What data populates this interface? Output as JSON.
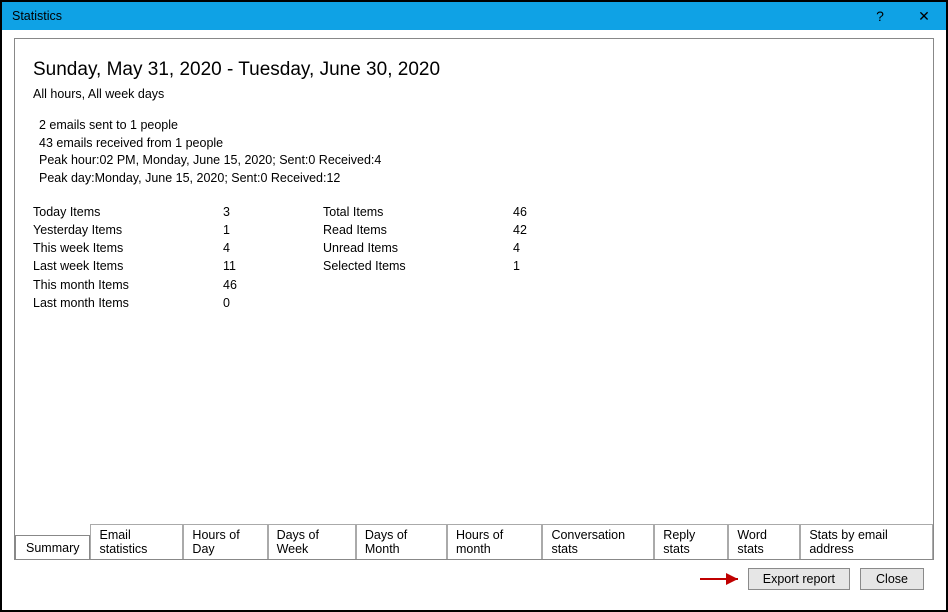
{
  "titlebar": {
    "title": "Statistics",
    "help_label": "?",
    "close_label": "✕"
  },
  "header": {
    "date_range": "Sunday, May 31, 2020 - Tuesday, June 30, 2020",
    "filter_text": "All hours, All week days"
  },
  "details": {
    "line1": "2 emails sent to 1 people",
    "line2": "43 emails received from 1 people",
    "line3": "Peak hour:02 PM, Monday, June 15, 2020; Sent:0 Received:4",
    "line4": "Peak day:Monday, June 15, 2020; Sent:0 Received:12"
  },
  "stats_left": {
    "labels": [
      "Today Items",
      "Yesterday Items",
      "This week Items",
      "Last week Items",
      "This month Items",
      "Last month Items"
    ],
    "values": [
      "3",
      "1",
      "4",
      "11",
      "46",
      "0"
    ]
  },
  "stats_right": {
    "labels": [
      "Total Items",
      "Read Items",
      "Unread Items",
      "Selected Items"
    ],
    "values": [
      "46",
      "42",
      "4",
      "1"
    ]
  },
  "tabs": {
    "t0": "Summary",
    "t1": "Email statistics",
    "t2": "Hours of Day",
    "t3": "Days of Week",
    "t4": "Days of Month",
    "t5": "Hours of month",
    "t6": "Conversation stats",
    "t7": "Reply stats",
    "t8": "Word stats",
    "t9": "Stats by email address"
  },
  "buttons": {
    "export": "Export report",
    "close": "Close"
  }
}
